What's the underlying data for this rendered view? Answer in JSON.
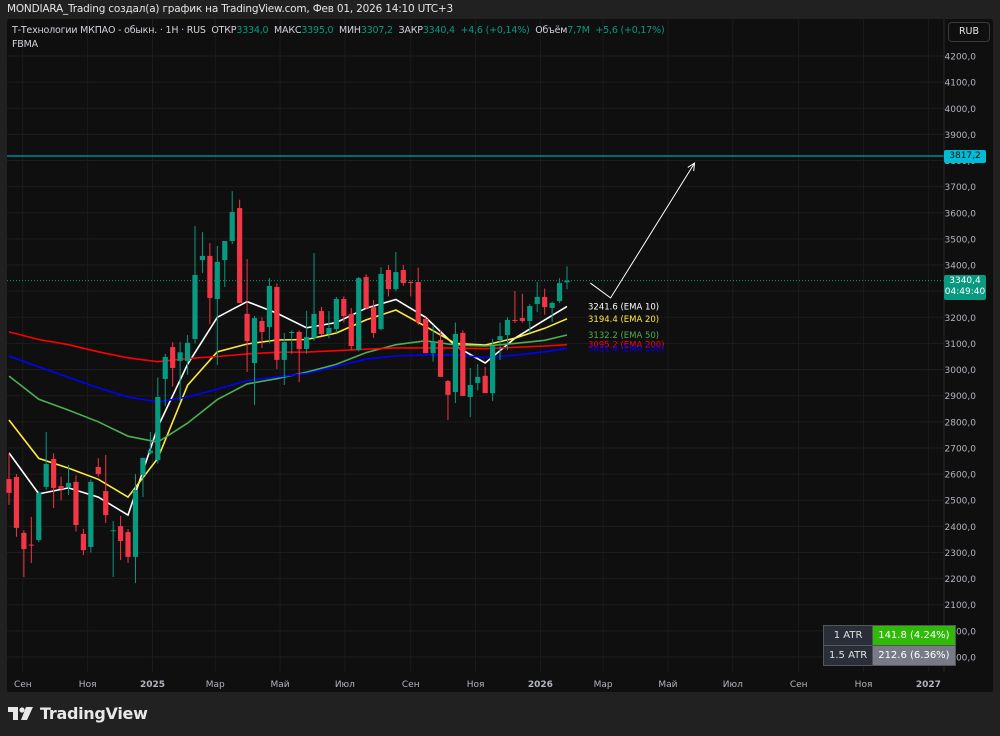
{
  "header": {
    "title": "MONDIARA_Trading создал(а) график на TradingView.com, Фев 01, 2026 14:10 UTC+3"
  },
  "legend": {
    "symbol": "Т-Технологии МКПАО - обыкн. · 1H · RUS",
    "open_label": "ОТКР",
    "open": "3334,0",
    "high_label": "МАКС",
    "high": "3395,0",
    "low_label": "МИН",
    "low": "3307,2",
    "close_label": "ЗАКР",
    "close": "3340,4",
    "change": "+4,6 (+0,14%)",
    "volume_label": "Объём",
    "volume": "7,7M",
    "volume_change": "+5,6 (+0,17%)",
    "indicator": "FBMA"
  },
  "currency": "RUB",
  "horizontal_line": {
    "value": 3817.2,
    "label": "3817,2",
    "color": "#00bcd4"
  },
  "last_price": {
    "value": 3340.4,
    "label": "3340,4",
    "countdown": "04:49:40",
    "color": "#089981"
  },
  "atr_table": [
    {
      "label": "1 ATR",
      "value": "141.8 (4.24%)",
      "color": "#2fba0a"
    },
    {
      "label": "1.5 ATR",
      "value": "212.6 (6.36%)",
      "color": "#787b86"
    }
  ],
  "branding": {
    "logo_text": "TradingView"
  },
  "chart_data": {
    "type": "candlestick",
    "interval": "1W",
    "colors": {
      "up": "#089981",
      "down": "#f23645"
    },
    "ylim": [
      1860,
      4260
    ],
    "y_ticks": [
      "1900,0",
      "2000,0",
      "2100,0",
      "2200,0",
      "2300,0",
      "2400,0",
      "2500,0",
      "2600,0",
      "2700,0",
      "2800,0",
      "2900,0",
      "3000,0",
      "3100,0",
      "3200,0",
      "3300,0",
      "3400,0",
      "3500,0",
      "3600,0",
      "3700,0",
      "3800,0",
      "3900,0",
      "4000,0",
      "4100,0",
      "4200,0"
    ],
    "x_ticks": [
      {
        "date": "2024-09-01",
        "label": "Сен"
      },
      {
        "date": "2024-11-01",
        "label": "Ноя"
      },
      {
        "date": "2025-01-01",
        "label": "2025"
      },
      {
        "date": "2025-03-01",
        "label": "Мар"
      },
      {
        "date": "2025-05-01",
        "label": "Май"
      },
      {
        "date": "2025-07-01",
        "label": "Июл"
      },
      {
        "date": "2025-09-01",
        "label": "Сен"
      },
      {
        "date": "2025-11-01",
        "label": "Ноя"
      },
      {
        "date": "2026-01-01",
        "label": "2026"
      },
      {
        "date": "2026-03-01",
        "label": "Мар"
      },
      {
        "date": "2026-05-01",
        "label": "Май"
      },
      {
        "date": "2026-07-01",
        "label": "Июл"
      },
      {
        "date": "2026-09-01",
        "label": "Сен"
      },
      {
        "date": "2026-11-01",
        "label": "Ноя"
      },
      {
        "date": "2027-01-01",
        "label": "2027"
      }
    ],
    "grid": true,
    "candles": [
      [
        2581,
        2681,
        2482,
        2528
      ],
      [
        2589,
        2600,
        2360,
        2394
      ],
      [
        2375,
        2385,
        2206,
        2313
      ],
      [
        2330,
        2436,
        2260,
        2329
      ],
      [
        2348,
        2535,
        2340,
        2528
      ],
      [
        2551,
        2761,
        2540,
        2639
      ],
      [
        2658,
        2680,
        2470,
        2547
      ],
      [
        2554,
        2590,
        2500,
        2543
      ],
      [
        2551,
        2635,
        2520,
        2566
      ],
      [
        2570,
        2595,
        2380,
        2405
      ],
      [
        2371,
        2390,
        2290,
        2309
      ],
      [
        2321,
        2580,
        2300,
        2570
      ],
      [
        2627,
        2661,
        2590,
        2600
      ],
      [
        2535,
        2673,
        2413,
        2443
      ],
      [
        2382,
        2420,
        2206,
        2385
      ],
      [
        2401,
        2440,
        2271,
        2344
      ],
      [
        2378,
        2390,
        2260,
        2283
      ],
      [
        2283,
        2600,
        2183,
        2539
      ],
      [
        2596,
        2662,
        2512,
        2662
      ],
      [
        2680,
        2761,
        2675,
        2690
      ],
      [
        2654,
        2970,
        2640,
        2895
      ],
      [
        2964,
        3060,
        2860,
        3048
      ],
      [
        3086,
        3105,
        2935,
        3006
      ],
      [
        3033,
        3105,
        2880,
        3066
      ],
      [
        3033,
        3132,
        2980,
        3102
      ],
      [
        3117,
        3549,
        3100,
        3362
      ],
      [
        3419,
        3526,
        3370,
        3435
      ],
      [
        3435,
        3484,
        3174,
        3274
      ],
      [
        3270,
        3473,
        3017,
        3412
      ],
      [
        3419,
        3430,
        3316,
        3492
      ],
      [
        3492,
        3683,
        3480,
        3603
      ],
      [
        3618,
        3650,
        3255,
        3255
      ],
      [
        3213,
        3423,
        2991,
        3109
      ],
      [
        3025,
        3205,
        2864,
        3197
      ],
      [
        3186,
        3200,
        3083,
        3144
      ],
      [
        3163,
        3350,
        3100,
        3320
      ],
      [
        3316,
        3330,
        3002,
        3037
      ],
      [
        3037,
        3140,
        2941,
        3105
      ],
      [
        3140,
        3150,
        3060,
        3144
      ],
      [
        3144,
        3150,
        2952,
        3079
      ],
      [
        3079,
        3224,
        3060,
        3125
      ],
      [
        3121,
        3446,
        3110,
        3213
      ],
      [
        3224,
        3240,
        3130,
        3136
      ],
      [
        3136,
        3224,
        3120,
        3159
      ],
      [
        3155,
        3278,
        3140,
        3270
      ],
      [
        3270,
        3280,
        3180,
        3205
      ],
      [
        3213,
        3236,
        3075,
        3090
      ],
      [
        3075,
        3354,
        3070,
        3350
      ],
      [
        3354,
        3365,
        3230,
        3236
      ],
      [
        3239,
        3266,
        3121,
        3140
      ],
      [
        3155,
        3392,
        3150,
        3366
      ],
      [
        3381,
        3400,
        3280,
        3308
      ],
      [
        3308,
        3450,
        3300,
        3373
      ],
      [
        3381,
        3400,
        3320,
        3331
      ],
      [
        3335,
        3340,
        3280,
        3331
      ],
      [
        3335,
        3390,
        3170,
        3182
      ],
      [
        3194,
        3200,
        3063,
        3063
      ],
      [
        3063,
        3171,
        3030,
        3105
      ],
      [
        3113,
        3148,
        2972,
        2972
      ],
      [
        2956,
        2960,
        2807,
        2903
      ],
      [
        2914,
        3180,
        2872,
        3136
      ],
      [
        3140,
        3150,
        2899,
        2899
      ],
      [
        2895,
        3006,
        2818,
        2941
      ],
      [
        2949,
        3021,
        2920,
        2972
      ],
      [
        2976,
        3010,
        2920,
        2910
      ],
      [
        2910,
        3117,
        2880,
        3090
      ],
      [
        3113,
        3180,
        3037,
        3128
      ],
      [
        3132,
        3200,
        3075,
        3190
      ],
      [
        3190,
        3301,
        3178,
        3186
      ],
      [
        3197,
        3290,
        3180,
        3186
      ],
      [
        3186,
        3250,
        3140,
        3243
      ],
      [
        3251,
        3335,
        3220,
        3278
      ],
      [
        3278,
        3310,
        3210,
        3239
      ],
      [
        3236,
        3260,
        3182,
        3255
      ],
      [
        3262,
        3350,
        3255,
        3331
      ],
      [
        3334,
        3395,
        3307.2,
        3340.4
      ]
    ],
    "candle_dates_first": "2024-08-19",
    "ema_dates": [
      "2024-08-19",
      "2024-09-16",
      "2024-10-14",
      "2024-11-11",
      "2024-12-09",
      "2025-01-06",
      "2025-02-03",
      "2025-03-03",
      "2025-03-31",
      "2025-04-28",
      "2025-05-26",
      "2025-06-23",
      "2025-07-21",
      "2025-08-18",
      "2025-09-15",
      "2025-10-13",
      "2025-11-10",
      "2025-12-08",
      "2026-01-05",
      "2026-01-26"
    ],
    "series": [
      {
        "name": "EMA 10",
        "color": "#ffffff",
        "label": "3241.6 (EMA 10)",
        "values": [
          2681,
          2524,
          2547,
          2512,
          2443,
          2780,
          3020,
          3200,
          3260,
          3216,
          3160,
          3180,
          3235,
          3268,
          3200,
          3090,
          3025,
          3120,
          3190,
          3241.6
        ]
      },
      {
        "name": "EMA 20",
        "color": "#ffeb3b",
        "label": "3194.4 (EMA 20)",
        "values": [
          2807,
          2660,
          2623,
          2580,
          2512,
          2660,
          2940,
          3068,
          3098,
          3113,
          3115,
          3140,
          3190,
          3228,
          3165,
          3100,
          3094,
          3120,
          3158,
          3194.4
        ]
      },
      {
        "name": "EMA 50",
        "color": "#4caf50",
        "label": "3132.2 (EMA 50)",
        "values": [
          2975,
          2886,
          2845,
          2800,
          2745,
          2722,
          2795,
          2885,
          2945,
          2965,
          2990,
          3020,
          3065,
          3095,
          3110,
          3094,
          3090,
          3100,
          3112,
          3132.2
        ]
      },
      {
        "name": "EMA 200",
        "color": "#ff0000",
        "label": "3095.2 (EMA 200)",
        "values": [
          3144,
          3115,
          3095,
          3068,
          3045,
          3030,
          3042,
          3050,
          3060,
          3066,
          3067,
          3072,
          3078,
          3083,
          3083,
          3082,
          3080,
          3085,
          3090,
          3095.2
        ]
      },
      {
        "name": "EMA 100",
        "color": "#0000ff",
        "label": "3081.4 (EMA 100)",
        "values": [
          3052,
          3010,
          2970,
          2930,
          2895,
          2876,
          2895,
          2925,
          2958,
          2972,
          2985,
          3012,
          3040,
          3052,
          3056,
          3056,
          3046,
          3055,
          3068,
          3081.4
        ]
      }
    ],
    "annotations": [
      {
        "type": "path-arrow",
        "color": "#ffffff",
        "points": [
          [
            "2026-02-17",
            3331
          ],
          [
            "2026-03-08",
            3274
          ],
          [
            "2026-05-26",
            3790
          ]
        ]
      }
    ]
  }
}
